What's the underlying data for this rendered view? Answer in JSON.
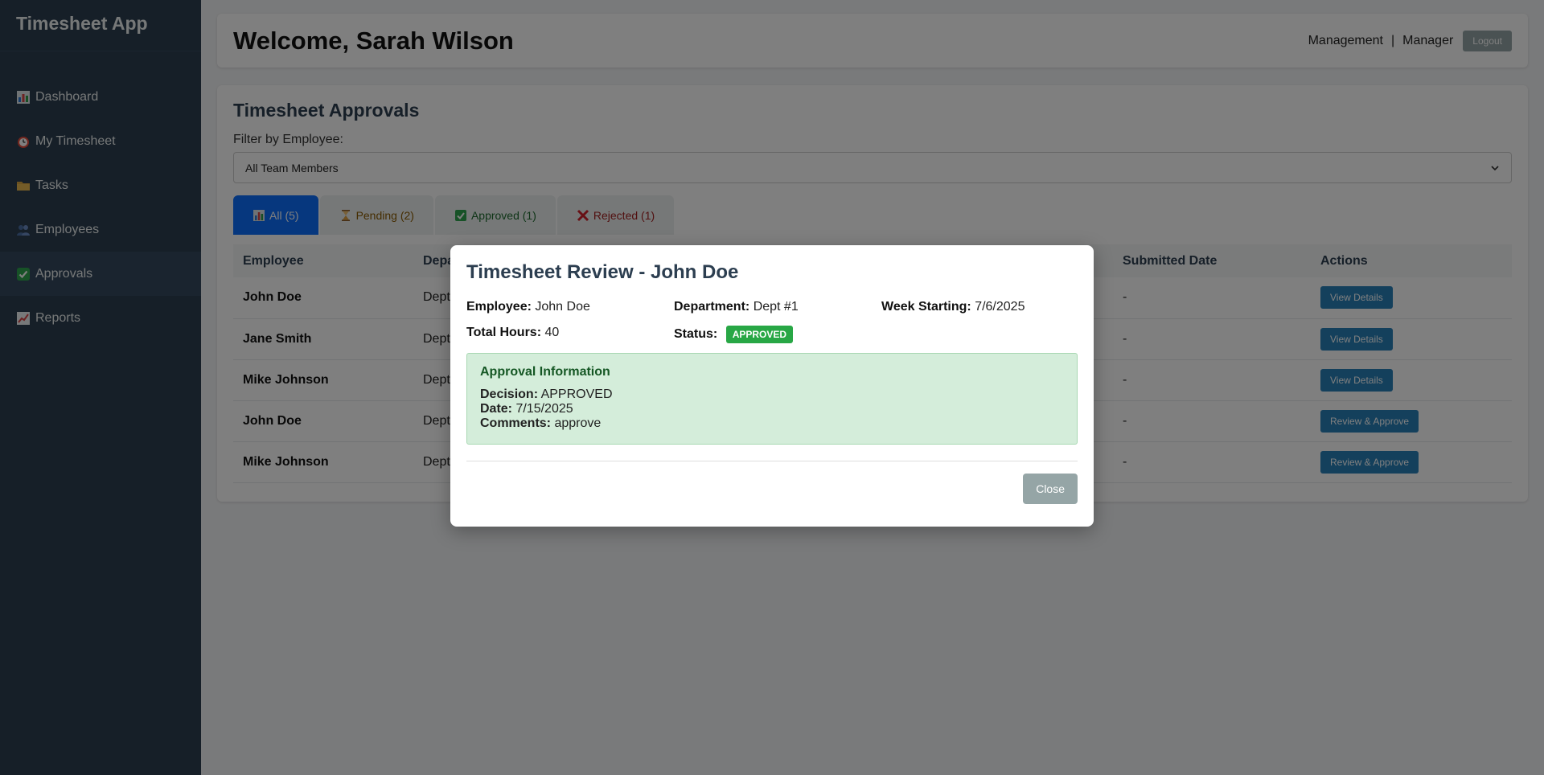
{
  "app": {
    "title": "Timesheet App"
  },
  "sidebar": {
    "items": [
      {
        "label": "Dashboard",
        "icon": "bar-chart-icon"
      },
      {
        "label": "My Timesheet",
        "icon": "alarm-clock-icon"
      },
      {
        "label": "Tasks",
        "icon": "folder-icon"
      },
      {
        "label": "Employees",
        "icon": "people-icon"
      },
      {
        "label": "Approvals",
        "icon": "check-box-icon"
      },
      {
        "label": "Reports",
        "icon": "trend-chart-icon"
      }
    ]
  },
  "header": {
    "welcome": "Welcome, Sarah Wilson",
    "department": "Management",
    "separator": "|",
    "role": "Manager",
    "logout_label": "Logout"
  },
  "approvals": {
    "title": "Timesheet Approvals",
    "filter_label": "Filter by Employee:",
    "filter_value": "All Team Members",
    "tabs": [
      {
        "label": "All (5)"
      },
      {
        "label": "Pending (2)"
      },
      {
        "label": "Approved (1)"
      },
      {
        "label": "Rejected (1)"
      }
    ],
    "columns": [
      "Employee",
      "Depa",
      "Submitted Date",
      "Actions"
    ],
    "rows": [
      {
        "employee": "John Doe",
        "dept": "Dept",
        "submitted": "-",
        "action": "View Details"
      },
      {
        "employee": "Jane Smith",
        "dept": "Dept",
        "submitted": "-",
        "action": "View Details"
      },
      {
        "employee": "Mike Johnson",
        "dept": "Dept",
        "submitted": "-",
        "action": "View Details"
      },
      {
        "employee": "John Doe",
        "dept": "Dept",
        "submitted": "-",
        "action": "Review & Approve"
      },
      {
        "employee": "Mike Johnson",
        "dept": "Dept",
        "submitted": "-",
        "action": "Review & Approve"
      }
    ]
  },
  "modal": {
    "title": "Timesheet Review - John Doe",
    "employee_label": "Employee:",
    "employee_value": "John Doe",
    "department_label": "Department:",
    "department_value": "Dept #1",
    "week_label": "Week Starting:",
    "week_value": "7/6/2025",
    "hours_label": "Total Hours:",
    "hours_value": "40",
    "status_label": "Status:",
    "status_value": "APPROVED",
    "approval": {
      "heading": "Approval Information",
      "decision_label": "Decision:",
      "decision_value": "APPROVED",
      "date_label": "Date:",
      "date_value": "7/15/2025",
      "comments_label": "Comments:",
      "comments_value": "approve"
    },
    "close_label": "Close"
  },
  "colors": {
    "sidebar_bg": "#2c3e50",
    "primary_tab": "#0d6efd",
    "action_button": "#2980b9",
    "approved_badge": "#28a745",
    "approval_box_bg": "#d4edda"
  }
}
